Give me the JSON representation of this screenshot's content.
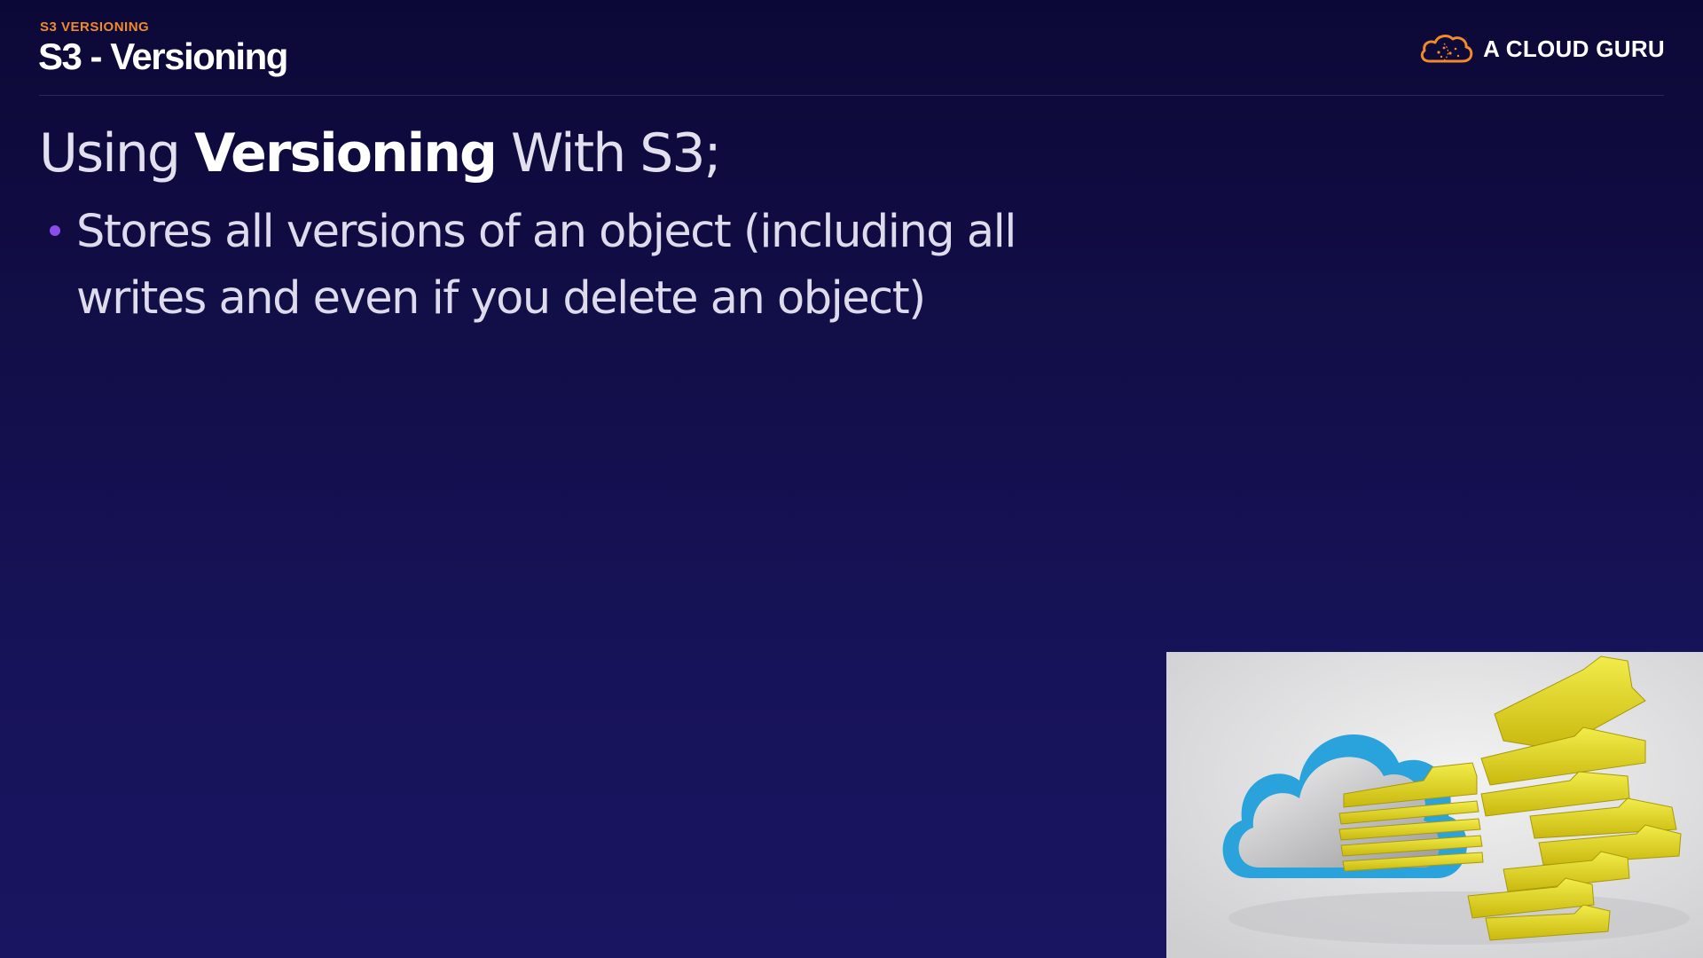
{
  "header": {
    "eyebrow": "S3 VERSIONING",
    "title": "S3 - Versioning"
  },
  "brand": {
    "name": "A CLOUD GURU",
    "logo_icon": "cloud-logo-icon",
    "logo_color": "#f08a2a"
  },
  "content": {
    "heading_prefix": "Using ",
    "heading_bold": "Versioning",
    "heading_suffix": " With S3;",
    "bullets": [
      "Stores all versions of an object (including all writes and even if you delete an object)"
    ]
  },
  "illustration": {
    "icon": "cloud-folders-illustration",
    "colors": {
      "cloud_outline": "#2aa3dc",
      "folders": "#e6dc1e",
      "background": "#e6e6e6"
    }
  },
  "colors": {
    "background_top": "#0c0836",
    "background_bottom": "#1a1560",
    "accent_orange": "#f08a2a",
    "bullet_purple": "#8b4de8"
  }
}
